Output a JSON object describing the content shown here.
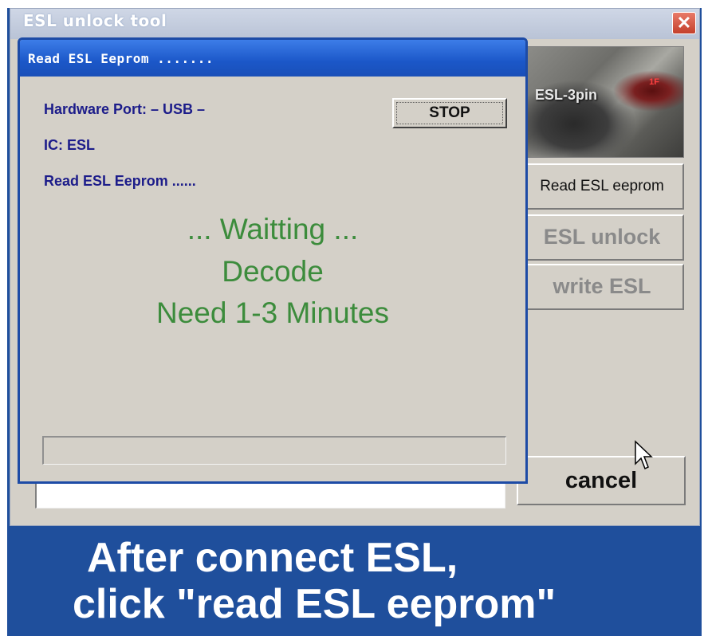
{
  "window": {
    "title": "ESL unlock tool",
    "close_glyph": "✕"
  },
  "photo": {
    "label": "ESL-3pin",
    "tag": "1F"
  },
  "side_buttons": {
    "read": "Read ESL eeprom",
    "unlock": "ESL unlock",
    "write": "write ESL",
    "cancel": "cancel"
  },
  "dialog": {
    "title": "Read ESL Eeprom .......",
    "hardware_port": "Hardware Port: – USB –",
    "ic": "IC: ESL",
    "reading": "Read ESL Eeprom ......",
    "stop_label": "STOP",
    "status_lines": [
      "... Waitting ...",
      "Decode",
      "Need 1-3 Minutes"
    ],
    "progress": 0
  },
  "caption": {
    "line1": "After connect ESL,",
    "line2": "click \"read ESL eeprom\""
  },
  "colors": {
    "frame_blue": "#1f4f9c",
    "status_green": "#3c8c3c",
    "info_blue": "#1c1c8a"
  }
}
